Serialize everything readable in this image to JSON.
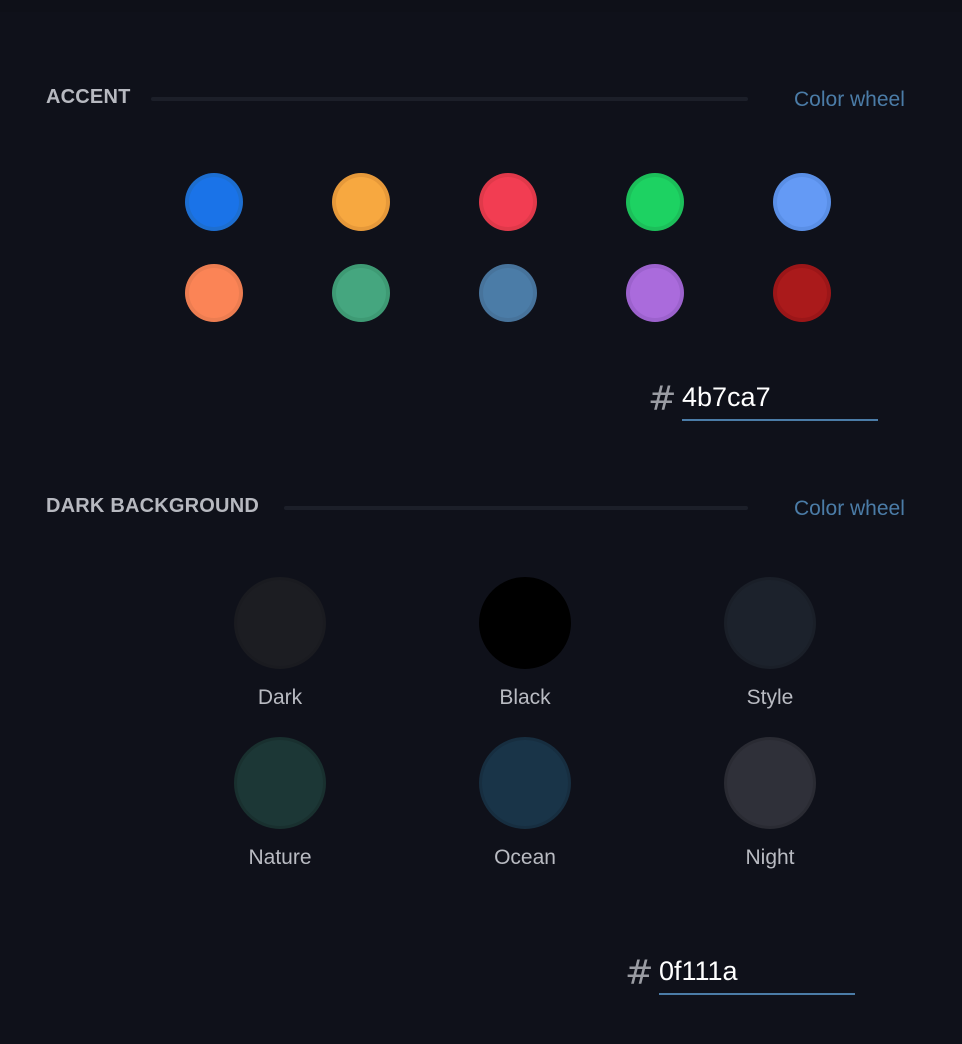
{
  "accent": {
    "title": "ACCENT",
    "color_wheel_label": "Color wheel",
    "swatches": [
      {
        "name": "blue",
        "outer": "#1d6ed0",
        "inner": "#1a73e8"
      },
      {
        "name": "orange",
        "outer": "#e6993a",
        "inner": "#f7a840"
      },
      {
        "name": "red",
        "outer": "#e0394a",
        "inner": "#f23d52"
      },
      {
        "name": "green",
        "outer": "#1cbf5a",
        "inner": "#1dd262"
      },
      {
        "name": "light-blue",
        "outer": "#5a8fe6",
        "inner": "#649af5"
      },
      {
        "name": "coral",
        "outer": "#ec7d51",
        "inner": "#fb8456"
      },
      {
        "name": "teal-green",
        "outer": "#3e9a74",
        "inner": "#45a67f"
      },
      {
        "name": "steel-blue",
        "outer": "#47739b",
        "inner": "#4b7ca7"
      },
      {
        "name": "purple",
        "outer": "#9c62cd",
        "inner": "#aa6bdc"
      },
      {
        "name": "dark-red",
        "outer": "#9b1618",
        "inner": "#aa1a1b"
      }
    ],
    "hash": "#",
    "hex_value": "4b7ca7"
  },
  "dark_background": {
    "title": "DARK BACKGROUND",
    "color_wheel_label": "Color wheel",
    "options": [
      {
        "label": "Dark",
        "fill": "#1c1d22",
        "border": "#1a1b20"
      },
      {
        "label": "Black",
        "fill": "#000000",
        "border": "#000000"
      },
      {
        "label": "Style",
        "fill": "#1c222c",
        "border": "#1a1f28"
      },
      {
        "label": "Nature",
        "fill": "#1c3736",
        "border": "#19302f"
      },
      {
        "label": "Ocean",
        "fill": "#193448",
        "border": "#172e40"
      },
      {
        "label": "Night",
        "fill": "#2f3039",
        "border": "#2a2b33"
      }
    ],
    "hash": "#",
    "hex_value": "0f111a"
  },
  "colors": {
    "background": "#0f111a",
    "link": "#4b7ca7"
  }
}
